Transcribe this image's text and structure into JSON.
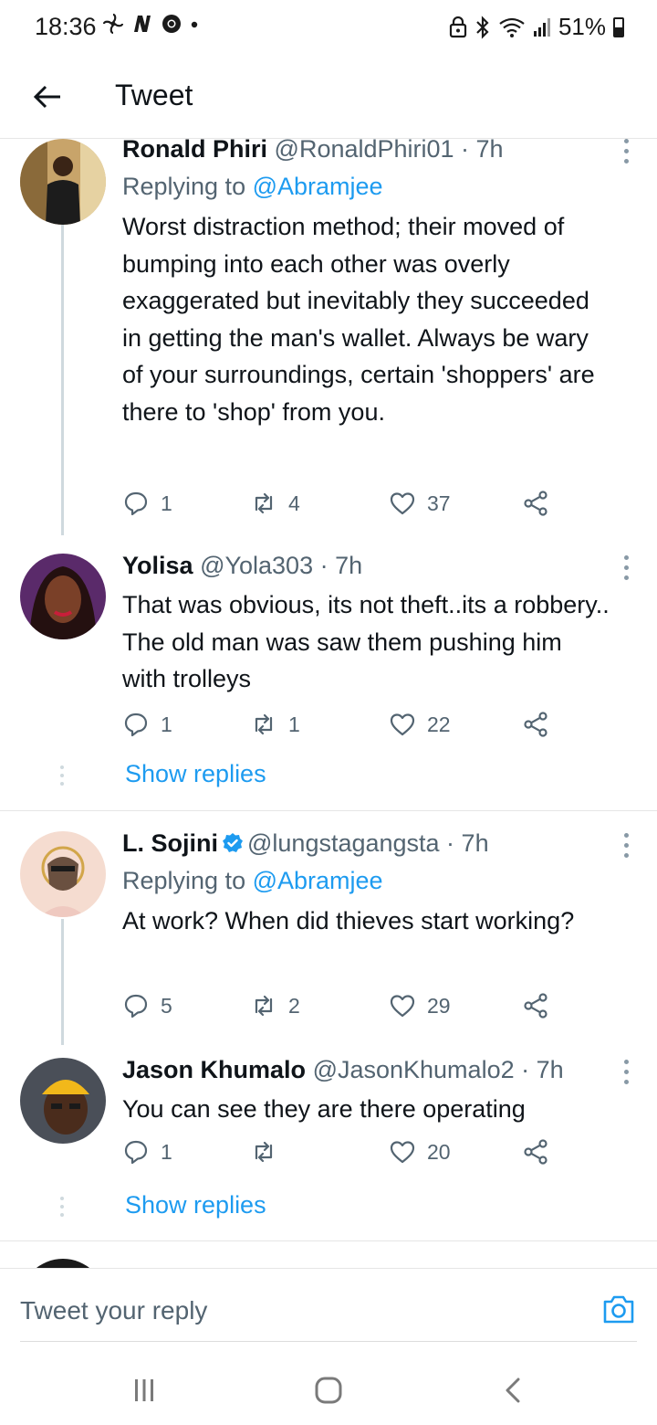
{
  "status_bar": {
    "time": "18:36",
    "left_icons": [
      "fan-icon",
      "n-icon",
      "chrome-icon",
      "dot-icon"
    ],
    "battery": "51%"
  },
  "header": {
    "title": "Tweet"
  },
  "tweets": [
    {
      "name": "Ronald Phiri",
      "handle": "@RonaldPhiri01 · 7h",
      "replying_label": "Replying to",
      "replying_to": "@Abramjee",
      "text": "Worst distraction method; their moved of bumping into each other was overly exaggerated but inevitably they succeeded in getting the man's wallet. Always be wary of your surroundings, certain 'shoppers' are there to 'shop' from you.",
      "replies": "1",
      "retweets": "4",
      "likes": "37"
    },
    {
      "name": "Yolisa",
      "handle": "@Yola303 · 7h",
      "text": "That was obvious, its not theft..its a robbery.. The old man was saw them pushing him with trolleys",
      "replies": "1",
      "retweets": "1",
      "likes": "22",
      "show_replies": "Show replies"
    },
    {
      "name": "L. Sojini",
      "handle": "@lungstagangsta · 7h",
      "replying_label": "Replying to",
      "replying_to": "@Abramjee",
      "text": "At work? When did thieves start working?",
      "replies": "5",
      "retweets": "2",
      "likes": "29"
    },
    {
      "name": "Jason Khumalo",
      "handle": "@JasonKhumalo2 · 7h",
      "text": "You can see they are there operating",
      "replies": "1",
      "retweets": "",
      "likes": "20",
      "show_replies": "Show replies"
    }
  ],
  "reply_box": {
    "placeholder": "Tweet your reply"
  },
  "colors": {
    "accent": "#1d9bf0",
    "secondary_text": "#536471",
    "thread_line": "#cfd9de"
  }
}
